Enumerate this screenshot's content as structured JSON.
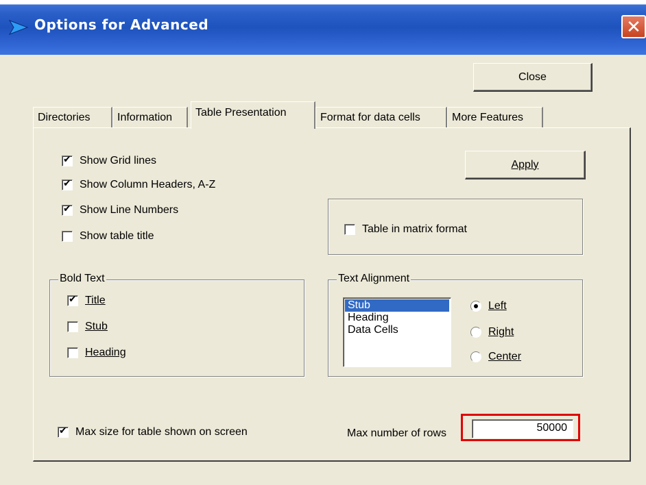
{
  "window": {
    "title": "Options for Advanced",
    "close_glyph": "✕"
  },
  "buttons": {
    "close": "Close",
    "apply": "Apply"
  },
  "tabs": [
    {
      "label": "Directories",
      "active": false
    },
    {
      "label": "Information",
      "active": false
    },
    {
      "label": "Table Presentation",
      "active": true
    },
    {
      "label": "Format for data cells",
      "active": false
    },
    {
      "label": "More Features",
      "active": false
    }
  ],
  "display_options": {
    "show_grid_lines": {
      "label": "Show Grid lines",
      "checked": true
    },
    "show_column_headers": {
      "label": "Show Column Headers, A-Z",
      "checked": true
    },
    "show_line_numbers": {
      "label": "Show Line Numbers",
      "checked": true
    },
    "show_table_title": {
      "label": "Show table title",
      "checked": false
    }
  },
  "matrix": {
    "label": "Table in matrix format",
    "checked": false
  },
  "bold_text": {
    "title": "Bold Text",
    "title_opt": {
      "label": "Title",
      "checked": true
    },
    "stub_opt": {
      "label": "Stub",
      "checked": false
    },
    "heading_opt": {
      "label": "Heading",
      "checked": false
    }
  },
  "text_alignment": {
    "title": "Text Alignment",
    "list": [
      "Stub",
      "Heading",
      "Data Cells"
    ],
    "selected_index": 0,
    "left": "Left",
    "right": "Right",
    "center": "Center",
    "selected_radio": "Left"
  },
  "max_size": {
    "label": "Max size for table shown on screen",
    "checked": true
  },
  "max_rows": {
    "label": "Max number of rows",
    "value": "50000"
  },
  "colors": {
    "title_bar": "#2a5fc8",
    "selection": "#316ac5",
    "highlight": "#e00000"
  }
}
